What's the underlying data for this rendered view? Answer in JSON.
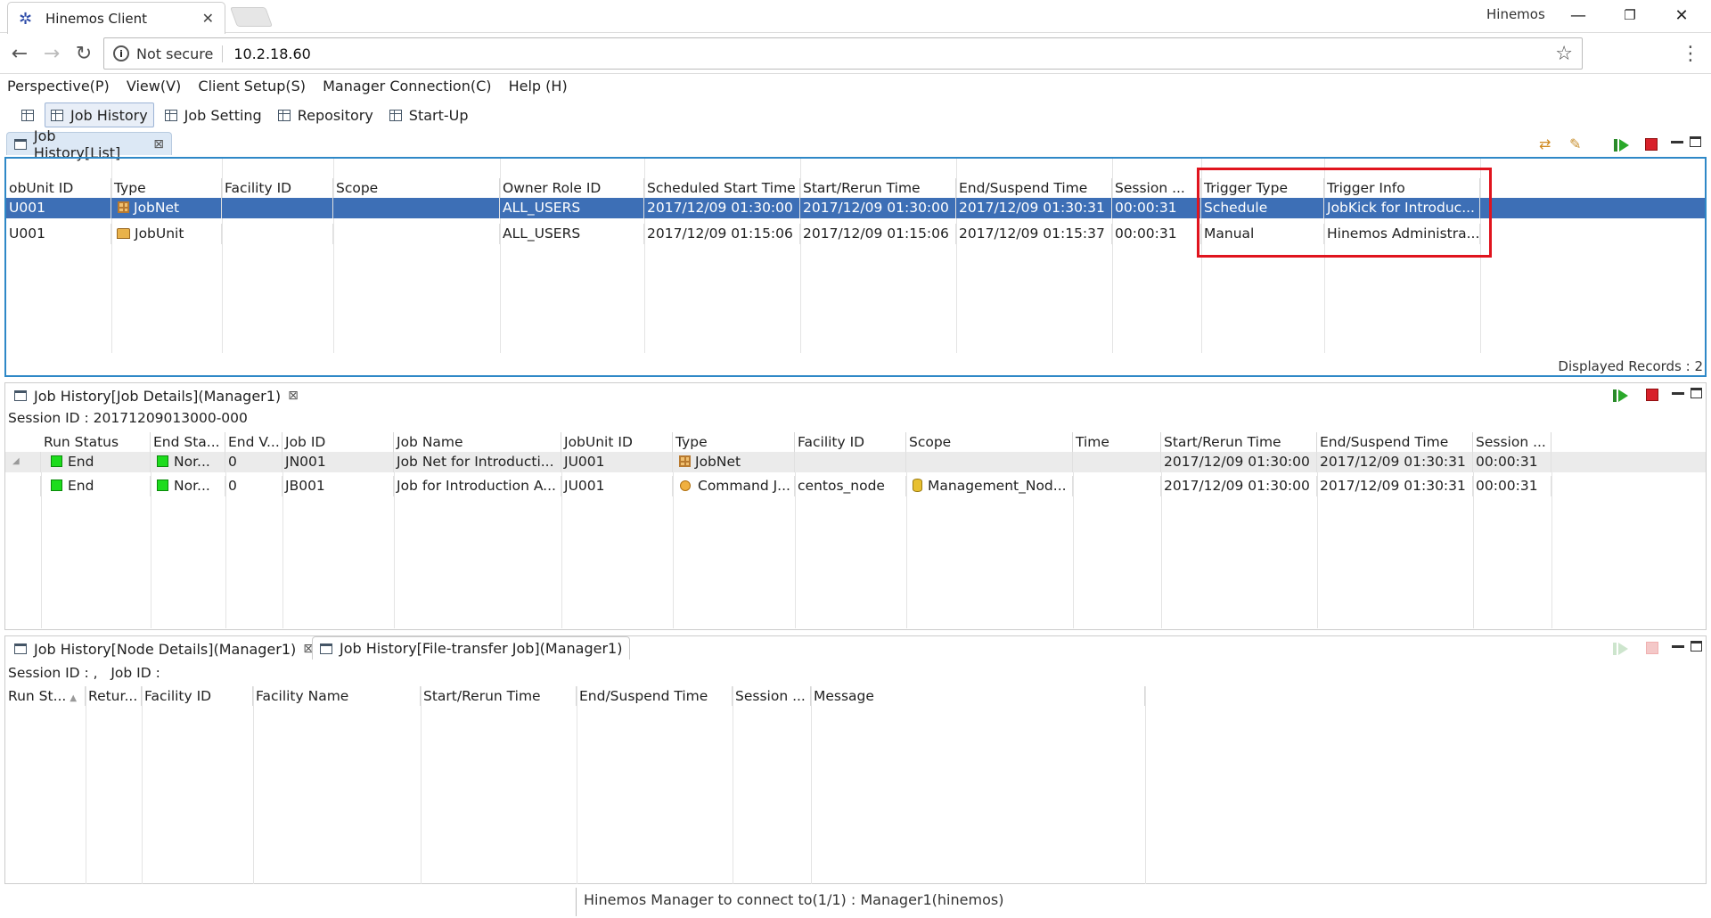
{
  "browser": {
    "tab_title": "Hinemos Client",
    "profile_name": "Hinemos",
    "security_label": "Not secure",
    "url": "10.2.18.60"
  },
  "menu": [
    "Perspective(P)",
    "View(V)",
    "Client Setup(S)",
    "Manager Connection(C)",
    "Help (H)"
  ],
  "perspectives": [
    "Job History",
    "Job Setting",
    "Repository",
    "Start-Up"
  ],
  "list_panel": {
    "tab_label": "Job History[List]",
    "columns": [
      "obUnit ID",
      "Type",
      "Facility ID",
      "Scope",
      "Owner Role ID",
      "Scheduled Start Time",
      "Start/Rerun Time",
      "End/Suspend Time",
      "Session ...",
      "Trigger Type",
      "Trigger Info"
    ],
    "rows": [
      {
        "jobunit": "U001",
        "type": "JobNet",
        "facility": "",
        "scope": "",
        "owner": "ALL_USERS",
        "scheduled": "2017/12/09 01:30:00",
        "start": "2017/12/09 01:30:00",
        "end": "2017/12/09 01:30:31",
        "session": "00:00:31",
        "trigger_type": "Schedule",
        "trigger_info": "JobKick for Introduc..."
      },
      {
        "jobunit": "U001",
        "type": "JobUnit",
        "facility": "",
        "scope": "",
        "owner": "ALL_USERS",
        "scheduled": "2017/12/09 01:15:06",
        "start": "2017/12/09 01:15:06",
        "end": "2017/12/09 01:15:37",
        "session": "00:00:31",
        "trigger_type": "Manual",
        "trigger_info": "Hinemos Administra..."
      }
    ],
    "displayed_records": "Displayed Records : 2"
  },
  "details_panel": {
    "tab_label": "Job History[Job Details](Manager1)",
    "session_id": "Session ID : 20171209013000-000",
    "columns": [
      "Run Status",
      "End Sta...",
      "End V...",
      "Job ID",
      "Job Name",
      "JobUnit ID",
      "Type",
      "Facility ID",
      "Scope",
      "Time",
      "Start/Rerun Time",
      "End/Suspend Time",
      "Session ..."
    ],
    "rows": [
      {
        "run": "End",
        "end_status": "Nor...",
        "end_value": "0",
        "job_id": "JN001",
        "job_name": "Job Net for Introducti...",
        "jobunit": "JU001",
        "type": "JobNet",
        "facility": "",
        "scope": "",
        "time": "",
        "start": "2017/12/09 01:30:00",
        "end": "2017/12/09 01:30:31",
        "session": "00:00:31"
      },
      {
        "run": "End",
        "end_status": "Nor...",
        "end_value": "0",
        "job_id": "JB001",
        "job_name": "Job for Introduction A...",
        "jobunit": "JU001",
        "type": "Command J...",
        "facility": "centos_node",
        "scope": "Management_Nod...",
        "time": "",
        "start": "2017/12/09 01:30:00",
        "end": "2017/12/09 01:30:31",
        "session": "00:00:31"
      }
    ]
  },
  "node_panel": {
    "tab_label": "Job History[Node Details](Manager1)",
    "tab2_label": "Job History[File-transfer Job](Manager1)",
    "session_line": "Session ID : ,   Job ID :",
    "columns": [
      "Run St...",
      "Retur...",
      "Facility ID",
      "Facility Name",
      "Start/Rerun Time",
      "End/Suspend Time",
      "Session ...",
      "Message"
    ]
  },
  "status_bar": "Hinemos Manager to connect to(1/1) : Manager1(hinemos)",
  "colors": {
    "selection": "#3d6fb6",
    "highlight_box": "#e0141e",
    "status_end": "#1ddc1d"
  }
}
